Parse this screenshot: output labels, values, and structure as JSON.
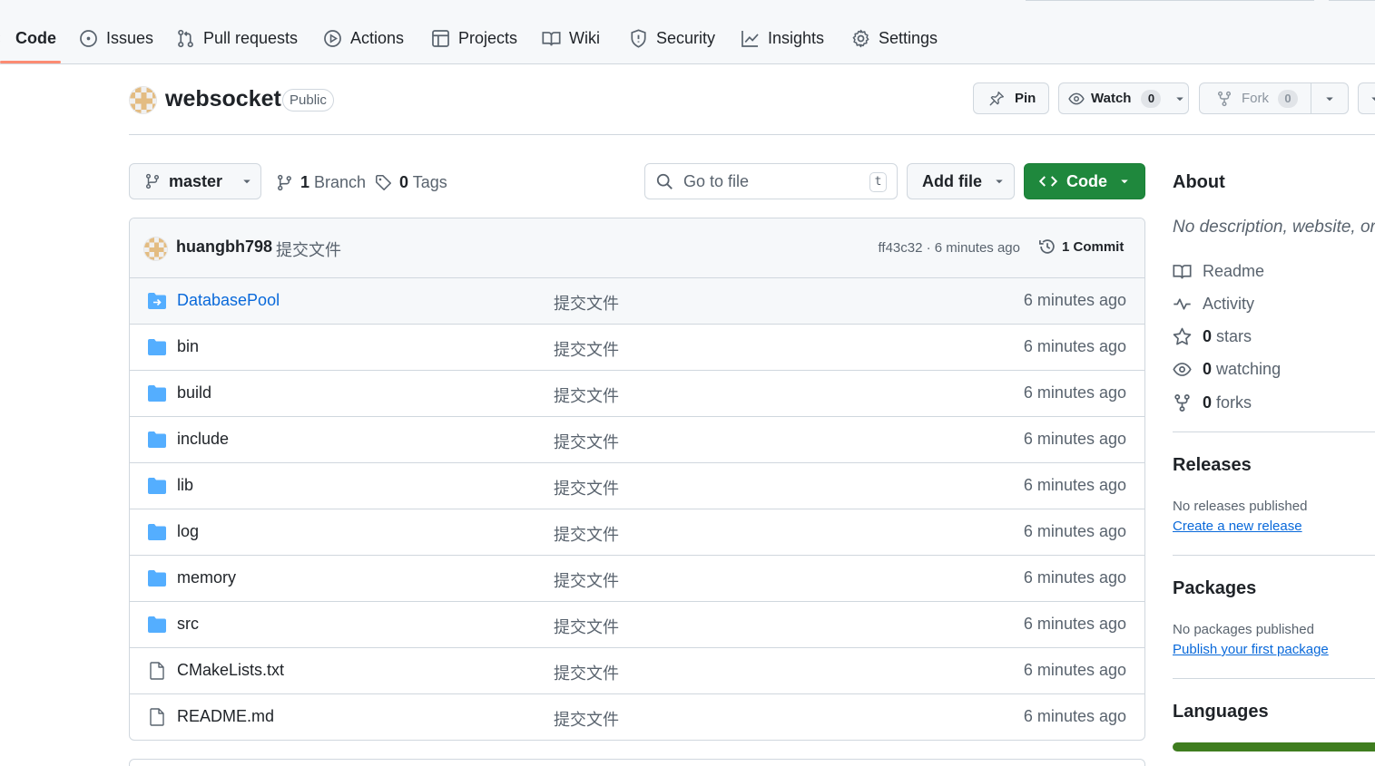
{
  "nav": {
    "tabs": [
      {
        "label": "Code",
        "icon": "code-icon"
      },
      {
        "label": "Issues",
        "icon": "issue-icon"
      },
      {
        "label": "Pull requests",
        "icon": "pull-request-icon"
      },
      {
        "label": "Actions",
        "icon": "play-icon"
      },
      {
        "label": "Projects",
        "icon": "table-icon"
      },
      {
        "label": "Wiki",
        "icon": "book-icon"
      },
      {
        "label": "Security",
        "icon": "shield-icon"
      },
      {
        "label": "Insights",
        "icon": "graph-icon"
      },
      {
        "label": "Settings",
        "icon": "gear-icon"
      }
    ],
    "active": "Code"
  },
  "repo": {
    "name": "websocket",
    "visibility": "Public",
    "pin_label": "Pin",
    "watch_label": "Watch",
    "watch_count": "0",
    "fork_label": "Fork",
    "fork_count": "0"
  },
  "toolbar": {
    "branch": "master",
    "branch_count": "1",
    "branch_label": "Branch",
    "tag_count": "0",
    "tag_label": "Tags",
    "search_placeholder": "Go to file",
    "search_shortcut": "t",
    "add_file_label": "Add file",
    "code_label": "Code"
  },
  "latest_commit": {
    "author": "huangbh798",
    "message": "提交文件",
    "hash_time": "ff43c32 · 6 minutes ago",
    "count_label": "1 Commit"
  },
  "files": [
    {
      "name": "DatabasePool",
      "type": "submodule",
      "message": "提交文件",
      "time": "6 minutes ago"
    },
    {
      "name": "bin",
      "type": "folder",
      "message": "提交文件",
      "time": "6 minutes ago"
    },
    {
      "name": "build",
      "type": "folder",
      "message": "提交文件",
      "time": "6 minutes ago"
    },
    {
      "name": "include",
      "type": "folder",
      "message": "提交文件",
      "time": "6 minutes ago"
    },
    {
      "name": "lib",
      "type": "folder",
      "message": "提交文件",
      "time": "6 minutes ago"
    },
    {
      "name": "log",
      "type": "folder",
      "message": "提交文件",
      "time": "6 minutes ago"
    },
    {
      "name": "memory",
      "type": "folder",
      "message": "提交文件",
      "time": "6 minutes ago"
    },
    {
      "name": "src",
      "type": "folder",
      "message": "提交文件",
      "time": "6 minutes ago"
    },
    {
      "name": "CMakeLists.txt",
      "type": "file",
      "message": "提交文件",
      "time": "6 minutes ago"
    },
    {
      "name": "README.md",
      "type": "file",
      "message": "提交文件",
      "time": "6 minutes ago"
    }
  ],
  "sidebar": {
    "about_title": "About",
    "about_desc": "No description, website, or",
    "items": [
      {
        "icon": "book-icon",
        "count": "",
        "label": "Readme"
      },
      {
        "icon": "pulse-icon",
        "count": "",
        "label": "Activity"
      },
      {
        "icon": "star-icon",
        "count": "0",
        "label": "stars"
      },
      {
        "icon": "eye-icon",
        "count": "0",
        "label": "watching"
      },
      {
        "icon": "fork-icon",
        "count": "0",
        "label": "forks"
      }
    ],
    "releases_title": "Releases",
    "releases_empty": "No releases published",
    "releases_link": "Create a new release",
    "packages_title": "Packages",
    "packages_empty": "No packages published",
    "packages_link": "Publish your first package",
    "languages_title": "Languages"
  },
  "colors": {
    "accent_underline": "#fd8c73",
    "primary_button": "#1f883d",
    "link": "#0969da",
    "folder": "#54aeff",
    "language_bar": "#3f7d1f"
  }
}
